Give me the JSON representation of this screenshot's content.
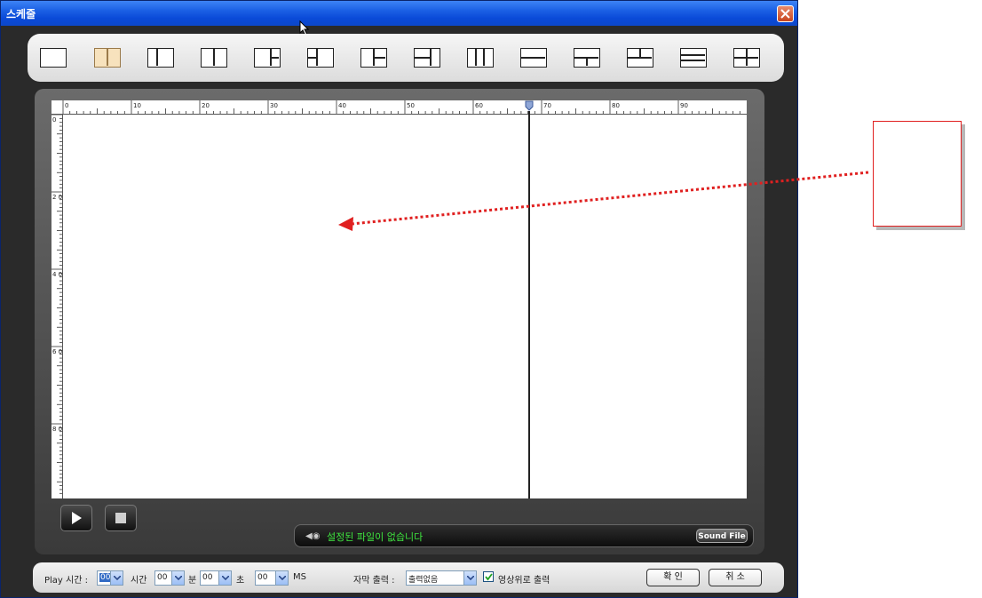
{
  "window": {
    "title": "스케줄"
  },
  "layout_toolbar": {
    "selected_index": 1,
    "buttons": [
      "layout-single",
      "layout-split-2-vertical",
      "layout-split-2-left-narrow",
      "layout-split-2-equal",
      "layout-split-3-right",
      "layout-split-3-left",
      "layout-split-3-center",
      "layout-split-3-mid",
      "layout-split-3-columns",
      "layout-split-2-horizontal",
      "layout-split-3-bottom",
      "layout-split-3-top",
      "layout-split-3-rows",
      "layout-split-4-grid"
    ]
  },
  "ruler": {
    "h_labels": [
      "0",
      "10",
      "20",
      "30",
      "40",
      "50",
      "60",
      "70",
      "80",
      "90"
    ],
    "v_labels": [
      "0",
      "2 0",
      "4 0",
      "6 0",
      "8 0"
    ]
  },
  "sound": {
    "status_text": "설정된 파일이 없습니다",
    "file_button_label": "Sound File"
  },
  "bottom": {
    "play_time_label": "Play 시간 :",
    "hour_value": "00",
    "hour_unit": "시간",
    "minute_value": "00",
    "minute_unit": "분",
    "second_value": "00",
    "second_unit": "초",
    "ms_value": "00",
    "ms_unit": "MS",
    "subtitle_label": "자막 출력 :",
    "subtitle_value": "출력없음",
    "overlay_label": "영상위로 출력",
    "overlay_checked": true,
    "ok_label": "확 인",
    "cancel_label": "취 소"
  },
  "colors": {
    "titlebar": "#0a4ad8",
    "selected_layout": "#f7e2bd",
    "status_text": "#3fe63f",
    "annotation": "#e02020"
  }
}
